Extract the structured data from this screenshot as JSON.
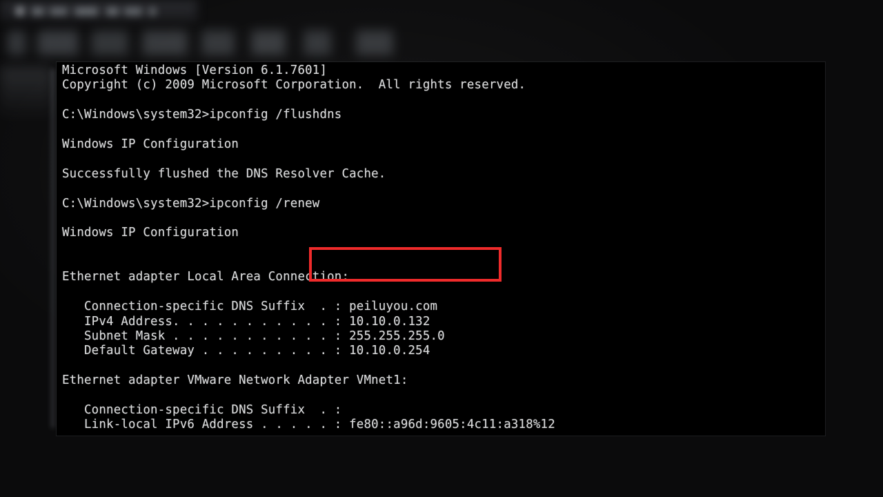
{
  "window": {
    "background_color": "#000000",
    "text_color": "#d9dadb",
    "title": ""
  },
  "backdrop": {
    "description": "blurred dark desktop behind console",
    "color": "#0b0b0c"
  },
  "annotation": {
    "color": "#ef2b2b",
    "target_text": ">ipconfig /renew",
    "shape": "rectangle-outline"
  },
  "console": {
    "lines": [
      "Microsoft Windows [Version 6.1.7601]",
      "Copyright (c) 2009 Microsoft Corporation.  All rights reserved.",
      "",
      "C:\\Windows\\system32>ipconfig /flushdns",
      "",
      "Windows IP Configuration",
      "",
      "Successfully flushed the DNS Resolver Cache.",
      "",
      "C:\\Windows\\system32>ipconfig /renew",
      "",
      "Windows IP Configuration",
      "",
      "",
      "Ethernet adapter Local Area Connection:",
      "",
      "   Connection-specific DNS Suffix  . : peiluyou.com",
      "   IPv4 Address. . . . . . . . . . . : 10.10.0.132",
      "   Subnet Mask . . . . . . . . . . . : 255.255.255.0",
      "   Default Gateway . . . . . . . . . : 10.10.0.254",
      "",
      "Ethernet adapter VMware Network Adapter VMnet1:",
      "",
      "   Connection-specific DNS Suffix  . :",
      "   Link-local IPv6 Address . . . . . : fe80::a96d:9605:4c11:a318%12"
    ],
    "commands": [
      "ipconfig /flushdns",
      "ipconfig /renew"
    ],
    "prompt": "C:\\Windows\\system32>",
    "os_version": "6.1.7601",
    "network": {
      "local_area_connection": {
        "dns_suffix": "peiluyou.com",
        "ipv4_address": "10.10.0.132",
        "subnet_mask": "255.255.255.0",
        "default_gateway": "10.10.0.254"
      },
      "vmnet1": {
        "dns_suffix": "",
        "link_local_ipv6": "fe80::a96d:9605:4c11:a318%12"
      }
    }
  }
}
